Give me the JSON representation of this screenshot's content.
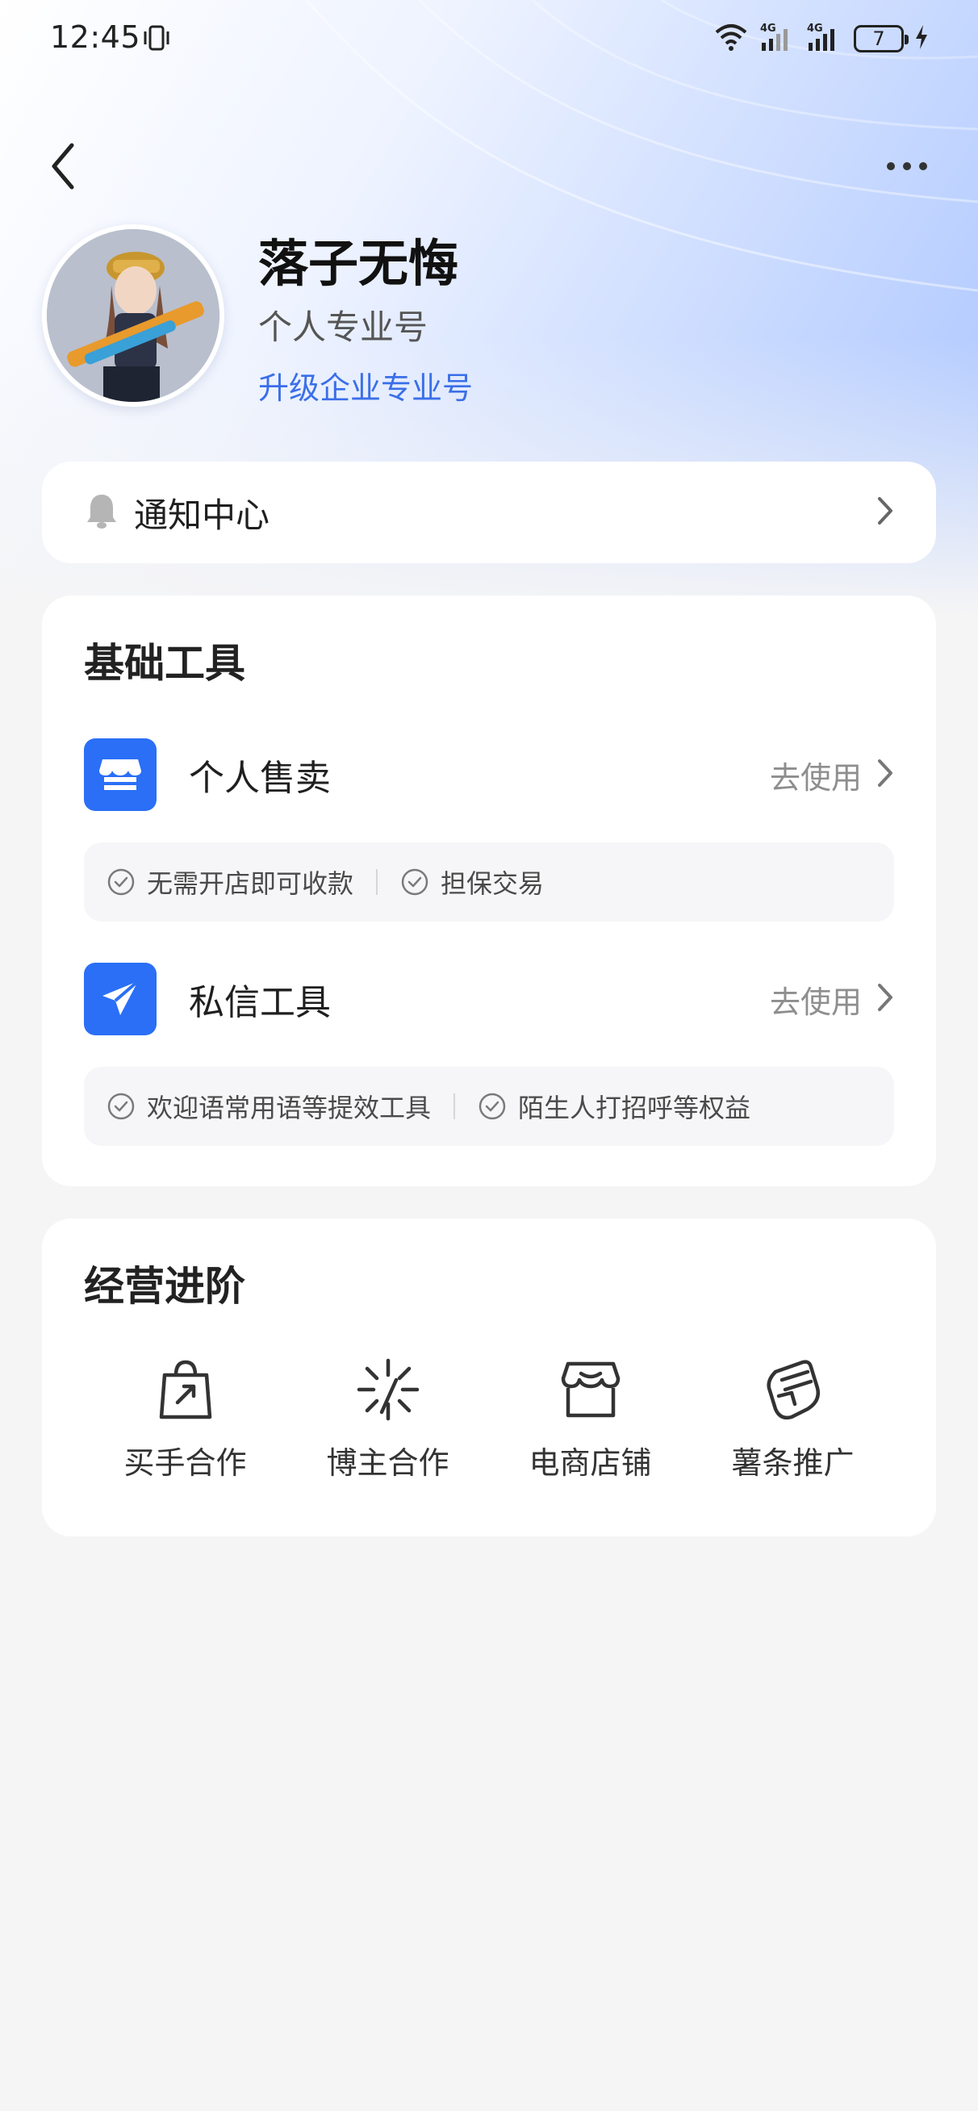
{
  "status_bar": {
    "time": "12:45",
    "battery": "7",
    "net_1": "4G",
    "net_2": "4G"
  },
  "profile": {
    "name": "落子无悔",
    "type": "个人专业号",
    "upgrade_link": "升级企业专业号"
  },
  "notify": {
    "label": "通知中心"
  },
  "basic_tools": {
    "title": "基础工具",
    "items": [
      {
        "name": "个人售卖",
        "action": "去使用",
        "icon": "store-icon",
        "features": [
          "无需开店即可收款",
          "担保交易"
        ]
      },
      {
        "name": "私信工具",
        "action": "去使用",
        "icon": "paper-plane-icon",
        "features": [
          "欢迎语常用语等提效工具",
          "陌生人打招呼等权益"
        ]
      }
    ]
  },
  "advanced": {
    "title": "经营进阶",
    "items": [
      {
        "label": "买手合作",
        "icon": "shopping-bag-icon"
      },
      {
        "label": "博主合作",
        "icon": "sparkle-icon"
      },
      {
        "label": "电商店铺",
        "icon": "shop-icon"
      },
      {
        "label": "薯条推广",
        "icon": "fist-icon"
      }
    ]
  },
  "colors": {
    "accent": "#2a6ff6",
    "link": "#3a6fe8",
    "background": "#f5f5f6"
  }
}
